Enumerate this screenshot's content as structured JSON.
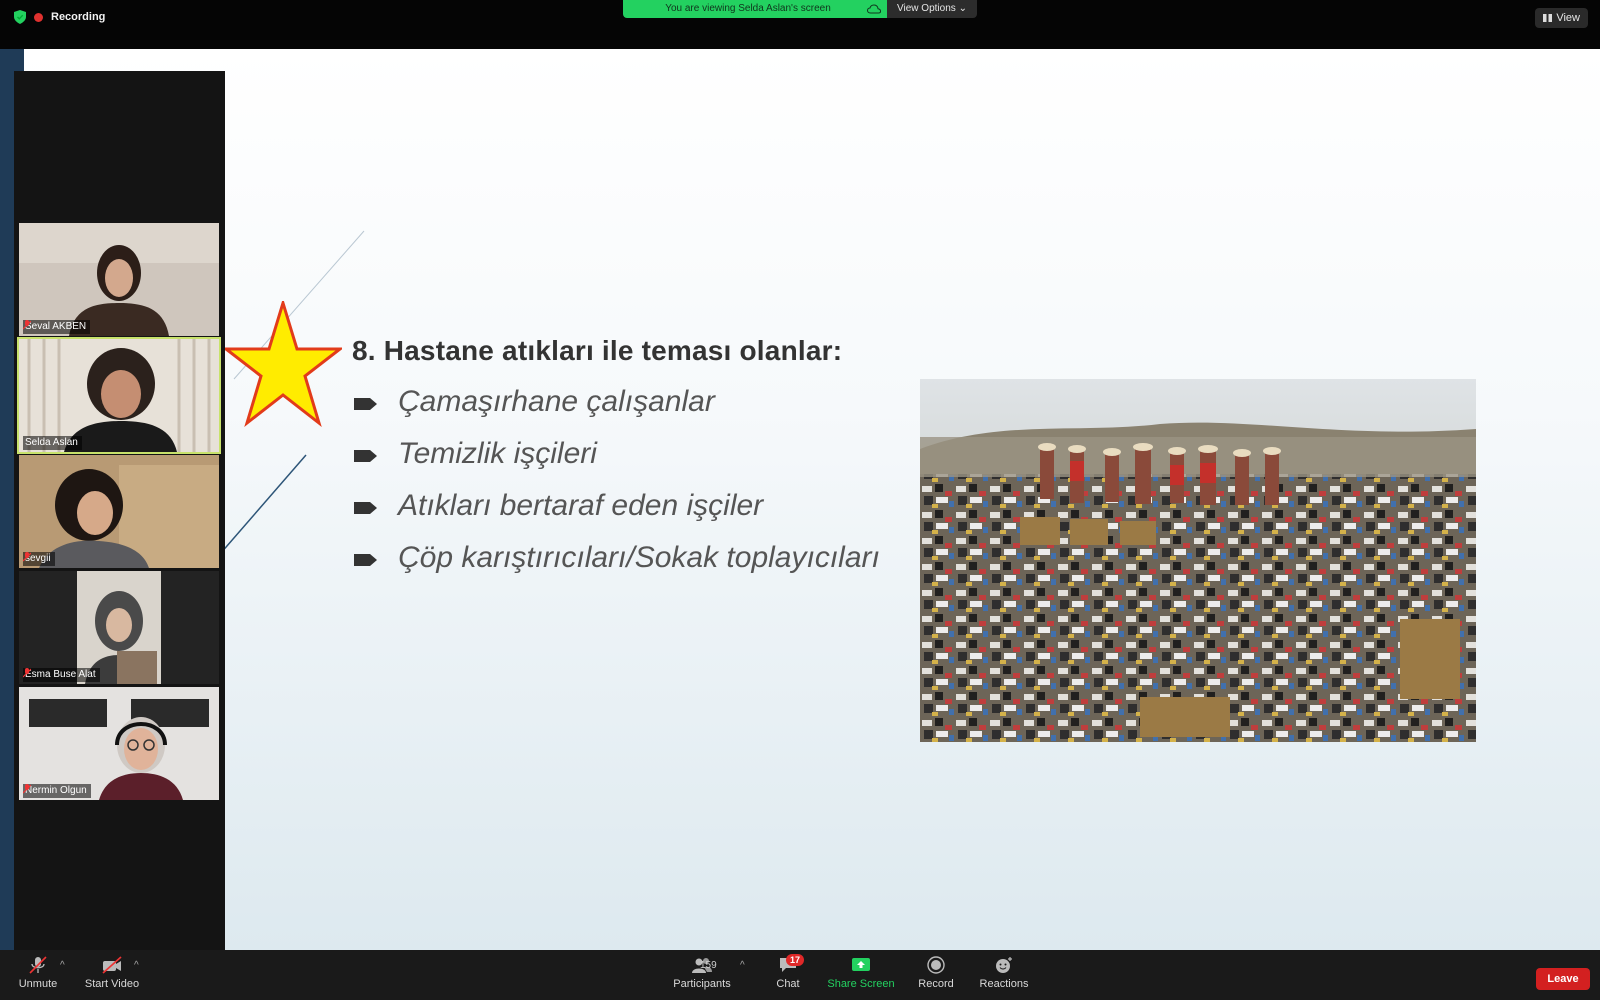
{
  "topbar": {
    "recording_label": "Recording",
    "share_banner": "You are viewing Selda Aslan's screen",
    "view_options_label": "View Options",
    "view_label": "View"
  },
  "slide": {
    "title": "8. Hastane atıkları ile teması olanlar:",
    "bullets": [
      "Çamaşırhane çalışanlar",
      "Temizlik işçileri",
      "Atıkları bertaraf eden işçiler",
      "Çöp karıştırıcıları/Sokak toplayıcıları"
    ]
  },
  "participants": [
    {
      "name": "Seval AKBEN",
      "muted": true
    },
    {
      "name": "Selda Aslan",
      "muted": false,
      "active": true
    },
    {
      "name": "sevgii",
      "muted": true
    },
    {
      "name": "Esma Buse Alat",
      "muted": true
    },
    {
      "name": "Nermin Olgun",
      "muted": true
    }
  ],
  "toolbar": {
    "unmute_label": "Unmute",
    "start_video_label": "Start Video",
    "participants_label": "Participants",
    "participants_count": "159",
    "chat_label": "Chat",
    "chat_badge": "17",
    "share_screen_label": "Share Screen",
    "record_label": "Record",
    "reactions_label": "Reactions",
    "leave_label": "Leave"
  },
  "colors": {
    "share_green": "#23d160",
    "leave_red": "#d32020",
    "active_speaker_outline": "#c8e26b"
  }
}
